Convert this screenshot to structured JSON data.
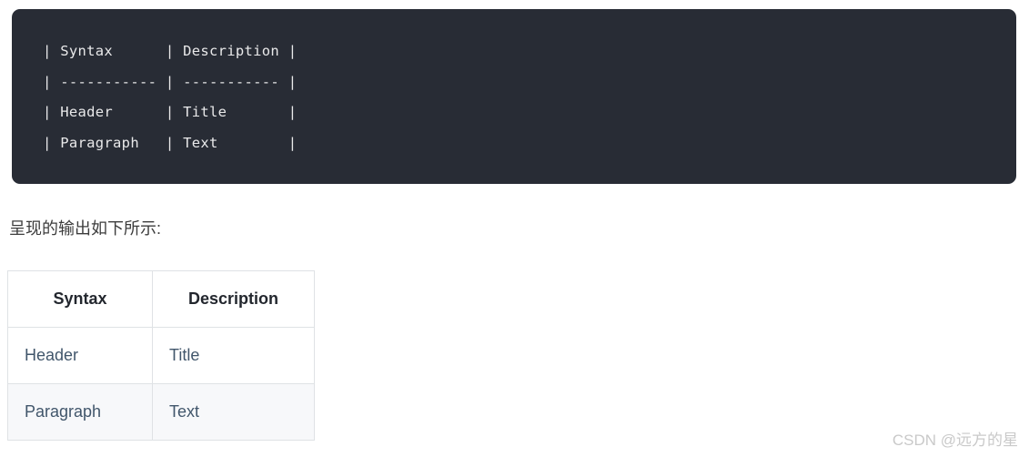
{
  "code_block": {
    "language": "markdown",
    "background_color": "#282c35",
    "text_color": "#e9e9ea",
    "lines": [
      "| Syntax    | Description |",
      "| ----------- | ----------- |",
      "| Header    | Title       |",
      "| Paragraph   | Text        |"
    ],
    "raw_rows": [
      {
        "syntax": "Syntax",
        "description": "Description"
      },
      {
        "syntax": "-----------",
        "description": "-----------"
      },
      {
        "syntax": "Header",
        "description": "Title"
      },
      {
        "syntax": "Paragraph",
        "description": "Text"
      }
    ]
  },
  "caption": {
    "text": "呈现的输出如下所示:"
  },
  "table": {
    "headers": [
      "Syntax",
      "Description"
    ],
    "rows": [
      [
        "Header",
        "Title"
      ],
      [
        "Paragraph",
        "Text"
      ]
    ],
    "header_text_color": "#23272e",
    "body_text_color": "#41566b",
    "border_color": "#dfe2e5",
    "alt_row_background": "#f7f8fa"
  },
  "watermark": {
    "text": "CSDN @远方的星"
  }
}
